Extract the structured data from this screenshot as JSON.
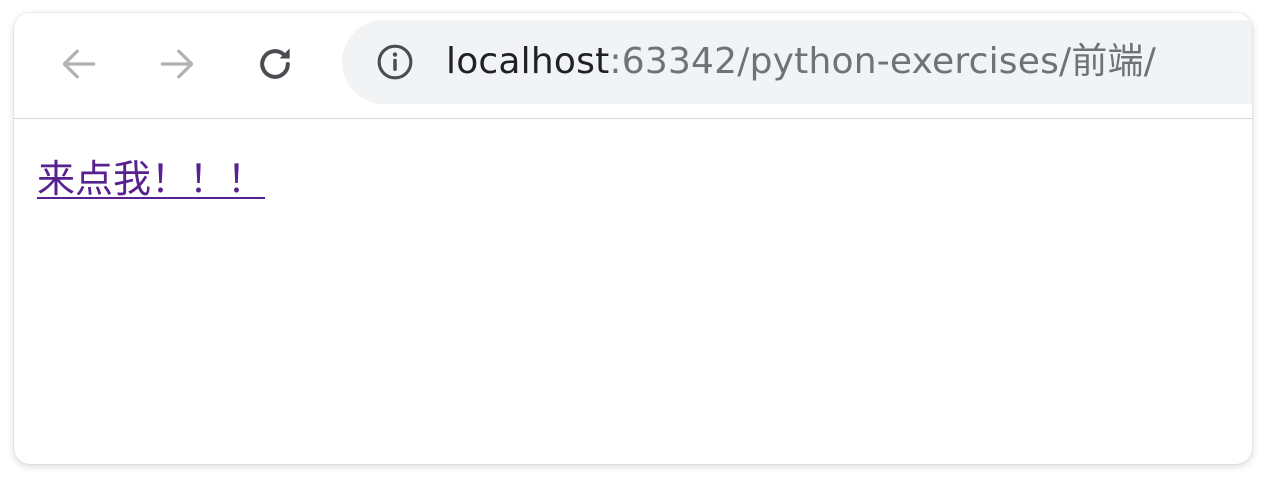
{
  "browser": {
    "nav": {
      "back_icon": "arrow-left-icon",
      "forward_icon": "arrow-right-icon",
      "reload_icon": "reload-icon"
    },
    "address_bar": {
      "info_icon": "info-icon",
      "url_host": "localhost",
      "url_rest": ":63342/python-exercises/前端/"
    }
  },
  "page": {
    "link_text": "来点我！！！"
  },
  "colors": {
    "visited_link": "#58218f",
    "omnibox_bg": "#f1f3f4",
    "icon_disabled": "#b0b3b6",
    "icon_active": "#4a4d51"
  }
}
